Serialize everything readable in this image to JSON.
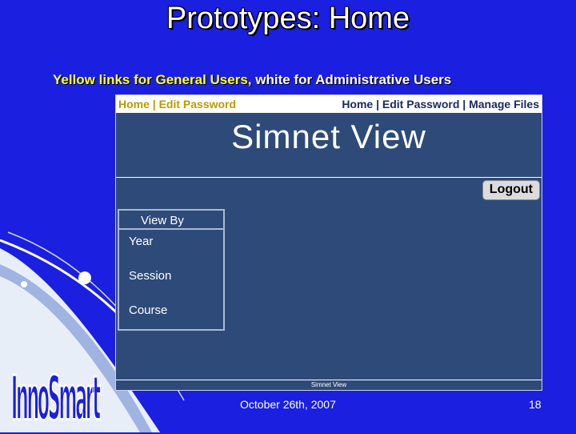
{
  "slide": {
    "title": "Prototypes: Home",
    "subtitle_yellow": "Yellow links for General Users,",
    "subtitle_white": "white for Administrative Users",
    "footer_date": "October 26th, 2007",
    "slide_number": "18",
    "logo_text": "InnoSmart"
  },
  "mockup": {
    "general_links": "Home | Edit Password",
    "admin_links": "Home | Edit Password | Manage Files",
    "app_title": "Simnet View",
    "logout_label": "Logout",
    "view_by": {
      "header": "View By",
      "items": [
        {
          "label": "Year"
        },
        {
          "label": "Session"
        },
        {
          "label": "Course"
        }
      ]
    },
    "footer_label": "Simnet View"
  },
  "colors": {
    "slide_background": "#1a1fe0",
    "mock_background": "#2e4a78",
    "general_link": "#b89b00",
    "admin_link": "#1a2a60"
  }
}
